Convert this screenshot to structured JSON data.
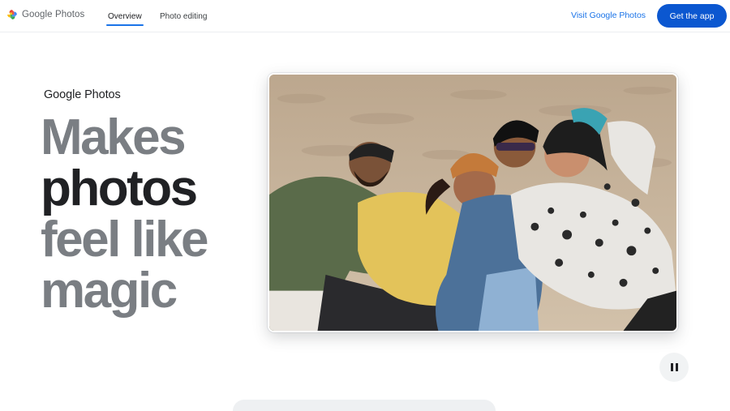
{
  "header": {
    "logo_text": "Google Photos",
    "tabs": [
      {
        "label": "Overview",
        "active": true
      },
      {
        "label": "Photo editing",
        "active": false
      }
    ],
    "visit_link": "Visit Google Photos",
    "cta_label": "Get the app"
  },
  "hero": {
    "brand": "Google Photos",
    "headline": [
      "Makes",
      "photos",
      "feel like",
      "magic"
    ]
  },
  "media": {
    "pause_icon": "pause-icon"
  },
  "colors": {
    "accent": "#1a73e8",
    "cta_bg": "#0b57d0",
    "headline_grey": "#7a7e83",
    "headline_dark": "#202124"
  }
}
